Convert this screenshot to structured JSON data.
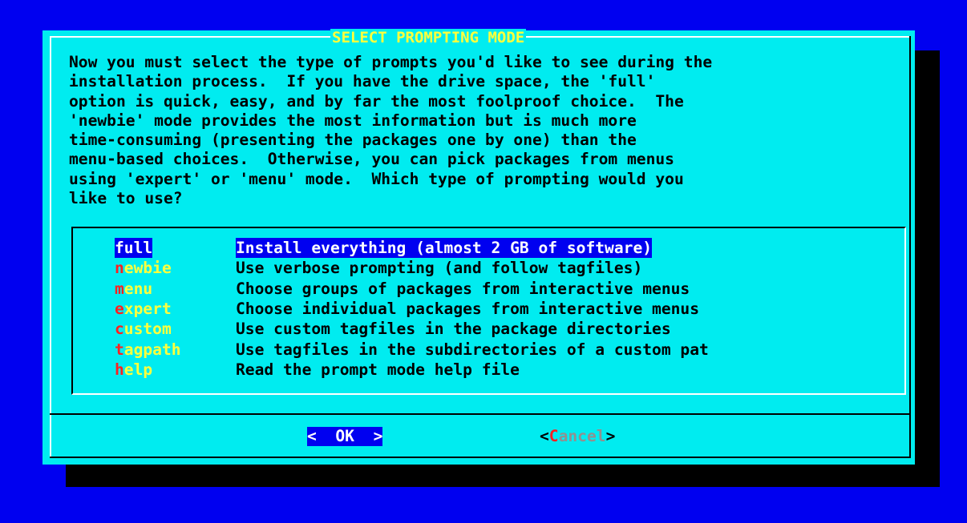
{
  "dialog": {
    "title": "SELECT PROMPTING MODE",
    "message": "Now you must select the type of prompts you'd like to see during the\ninstallation process.  If you have the drive space, the 'full'\noption is quick, easy, and by far the most foolproof choice.  The\n'newbie' mode provides the most information but is much more\ntime-consuming (presenting the packages one by one) than the\nmenu-based choices.  Otherwise, you can pick packages from menus\nusing 'expert' or 'menu' mode.  Which type of prompting would you\nlike to use?"
  },
  "menu": {
    "items": [
      {
        "tag": "full",
        "hot": "f",
        "rest": "ull",
        "desc": "Install everything (almost 2 GB of software)",
        "selected": true
      },
      {
        "tag": "newbie",
        "hot": "n",
        "rest": "ewbie",
        "desc": "Use verbose prompting (and follow tagfiles)",
        "selected": false
      },
      {
        "tag": "menu",
        "hot": "m",
        "rest": "enu",
        "desc": "Choose groups of packages from interactive menus",
        "selected": false
      },
      {
        "tag": "expert",
        "hot": "e",
        "rest": "xpert",
        "desc": "Choose individual packages from interactive menus",
        "selected": false
      },
      {
        "tag": "custom",
        "hot": "c",
        "rest": "ustom",
        "desc": "Use custom tagfiles in the package directories",
        "selected": false
      },
      {
        "tag": "tagpath",
        "hot": "t",
        "rest": "agpath",
        "desc": "Use tagfiles in the subdirectories of a custom pat",
        "selected": false
      },
      {
        "tag": "help",
        "hot": "h",
        "rest": "elp",
        "desc": "Read the prompt mode help file",
        "selected": false
      }
    ]
  },
  "buttons": {
    "ok_label": "<  OK  >",
    "cancel_open": "<",
    "cancel_hot": "C",
    "cancel_rest": "ancel",
    "cancel_close": ">"
  },
  "colors": {
    "screen_bg": "#0000f0",
    "dialog_bg": "#00ecf0",
    "title": "#ffff3c",
    "hotkey": "#ff2020",
    "highlight_bg": "#0000f0"
  }
}
